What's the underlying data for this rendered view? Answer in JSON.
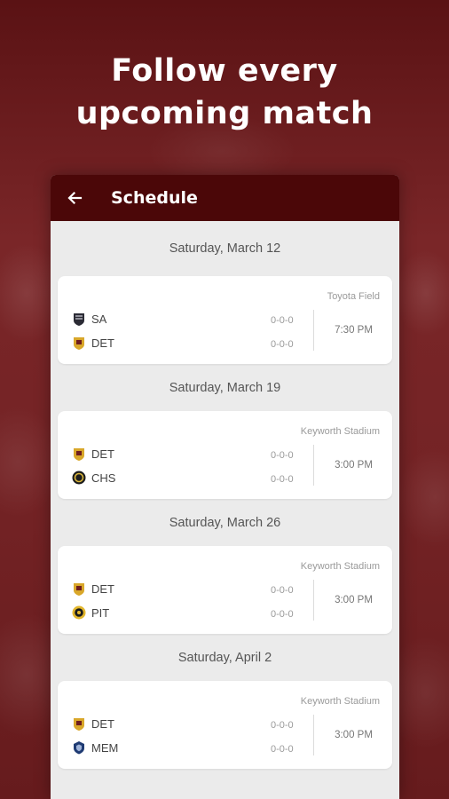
{
  "headline": {
    "line1": "Follow every",
    "line2": "upcoming match"
  },
  "appbar": {
    "back_icon": "arrow-left-icon",
    "title": "Schedule"
  },
  "colors": {
    "background": "#6e1d1e",
    "appbar": "#4b0708",
    "list_bg": "#ebebeb",
    "card_bg": "#ffffff"
  },
  "matches": [
    {
      "date": "Saturday, March 12",
      "venue": "Toyota Field",
      "home": {
        "abbr": "SA",
        "record": "0-0-0",
        "logo": "sa-crest-icon"
      },
      "away": {
        "abbr": "DET",
        "record": "0-0-0",
        "logo": "det-crest-icon"
      },
      "time": "7:30 PM"
    },
    {
      "date": "Saturday, March 19",
      "venue": "Keyworth Stadium",
      "home": {
        "abbr": "DET",
        "record": "0-0-0",
        "logo": "det-crest-icon"
      },
      "away": {
        "abbr": "CHS",
        "record": "0-0-0",
        "logo": "chs-crest-icon"
      },
      "time": "3:00 PM"
    },
    {
      "date": "Saturday, March 26",
      "venue": "Keyworth Stadium",
      "home": {
        "abbr": "DET",
        "record": "0-0-0",
        "logo": "det-crest-icon"
      },
      "away": {
        "abbr": "PIT",
        "record": "0-0-0",
        "logo": "pit-crest-icon"
      },
      "time": "3:00 PM"
    },
    {
      "date": "Saturday, April 2",
      "venue": "Keyworth Stadium",
      "home": {
        "abbr": "DET",
        "record": "0-0-0",
        "logo": "det-crest-icon"
      },
      "away": {
        "abbr": "MEM",
        "record": "0-0-0",
        "logo": "mem-crest-icon"
      },
      "time": "3:00 PM"
    }
  ]
}
